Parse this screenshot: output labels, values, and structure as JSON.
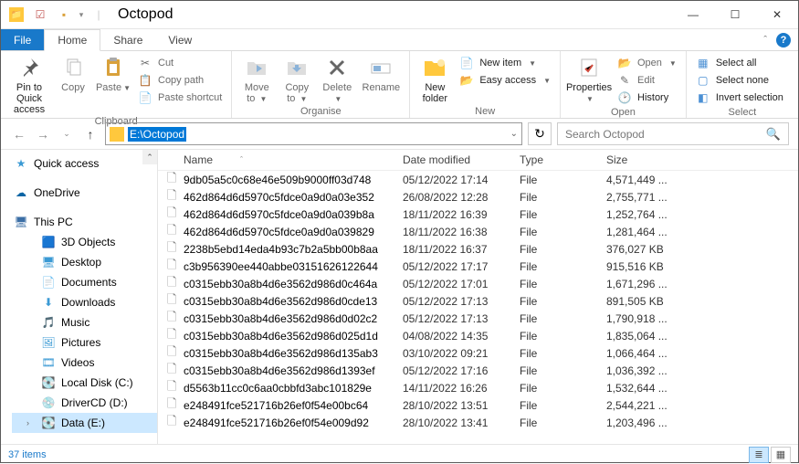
{
  "window": {
    "title": "Octopod"
  },
  "ribbon": {
    "tabs": {
      "file": "File",
      "home": "Home",
      "share": "Share",
      "view": "View"
    },
    "clipboard": {
      "label": "Clipboard",
      "pin": "Pin to Quick\naccess",
      "copy": "Copy",
      "paste": "Paste",
      "cut": "Cut",
      "copy_path": "Copy path",
      "paste_shortcut": "Paste shortcut"
    },
    "organise": {
      "label": "Organise",
      "move_to": "Move\nto",
      "copy_to": "Copy\nto",
      "delete": "Delete",
      "rename": "Rename"
    },
    "new": {
      "label": "New",
      "new_folder": "New\nfolder",
      "new_item": "New item",
      "easy_access": "Easy access"
    },
    "open": {
      "label": "Open",
      "properties": "Properties",
      "open": "Open",
      "edit": "Edit",
      "history": "History"
    },
    "select": {
      "label": "Select",
      "all": "Select all",
      "none": "Select none",
      "invert": "Invert selection"
    }
  },
  "nav": {
    "path": "E:\\Octopod",
    "search_placeholder": "Search Octopod"
  },
  "sidebar": {
    "quick": "Quick access",
    "onedrive": "OneDrive",
    "thispc": "This PC",
    "items": [
      {
        "label": "3D Objects"
      },
      {
        "label": "Desktop"
      },
      {
        "label": "Documents"
      },
      {
        "label": "Downloads"
      },
      {
        "label": "Music"
      },
      {
        "label": "Pictures"
      },
      {
        "label": "Videos"
      },
      {
        "label": "Local Disk (C:)"
      },
      {
        "label": "DriverCD (D:)"
      },
      {
        "label": "Data (E:)"
      }
    ]
  },
  "columns": {
    "name": "Name",
    "date": "Date modified",
    "type": "Type",
    "size": "Size"
  },
  "files": [
    {
      "name": "9db05a5c0c68e46e509b9000ff03d748",
      "date": "05/12/2022 17:14",
      "type": "File",
      "size": "4,571,449 ..."
    },
    {
      "name": "462d864d6d5970c5fdce0a9d0a03e352",
      "date": "26/08/2022 12:28",
      "type": "File",
      "size": "2,755,771 ..."
    },
    {
      "name": "462d864d6d5970c5fdce0a9d0a039b8a",
      "date": "18/11/2022 16:39",
      "type": "File",
      "size": "1,252,764 ..."
    },
    {
      "name": "462d864d6d5970c5fdce0a9d0a039829",
      "date": "18/11/2022 16:38",
      "type": "File",
      "size": "1,281,464 ..."
    },
    {
      "name": "2238b5ebd14eda4b93c7b2a5bb00b8aa",
      "date": "18/11/2022 16:37",
      "type": "File",
      "size": "376,027 KB"
    },
    {
      "name": "c3b956390ee440abbe03151626122644",
      "date": "05/12/2022 17:17",
      "type": "File",
      "size": "915,516 KB"
    },
    {
      "name": "c0315ebb30a8b4d6e3562d986d0c464a",
      "date": "05/12/2022 17:01",
      "type": "File",
      "size": "1,671,296 ..."
    },
    {
      "name": "c0315ebb30a8b4d6e3562d986d0cde13",
      "date": "05/12/2022 17:13",
      "type": "File",
      "size": "891,505 KB"
    },
    {
      "name": "c0315ebb30a8b4d6e3562d986d0d02c2",
      "date": "05/12/2022 17:13",
      "type": "File",
      "size": "1,790,918 ..."
    },
    {
      "name": "c0315ebb30a8b4d6e3562d986d025d1d",
      "date": "04/08/2022 14:35",
      "type": "File",
      "size": "1,835,064 ..."
    },
    {
      "name": "c0315ebb30a8b4d6e3562d986d135ab3",
      "date": "03/10/2022 09:21",
      "type": "File",
      "size": "1,066,464 ..."
    },
    {
      "name": "c0315ebb30a8b4d6e3562d986d1393ef",
      "date": "05/12/2022 17:16",
      "type": "File",
      "size": "1,036,392 ..."
    },
    {
      "name": "d5563b11cc0c6aa0cbbfd3abc101829e",
      "date": "14/11/2022 16:26",
      "type": "File",
      "size": "1,532,644 ..."
    },
    {
      "name": "e248491fce521716b26ef0f54e00bc64",
      "date": "28/10/2022 13:51",
      "type": "File",
      "size": "2,544,221 ..."
    },
    {
      "name": "e248491fce521716b26ef0f54e009d92",
      "date": "28/10/2022 13:41",
      "type": "File",
      "size": "1,203,496 ..."
    }
  ],
  "status": {
    "count": "37 items"
  }
}
